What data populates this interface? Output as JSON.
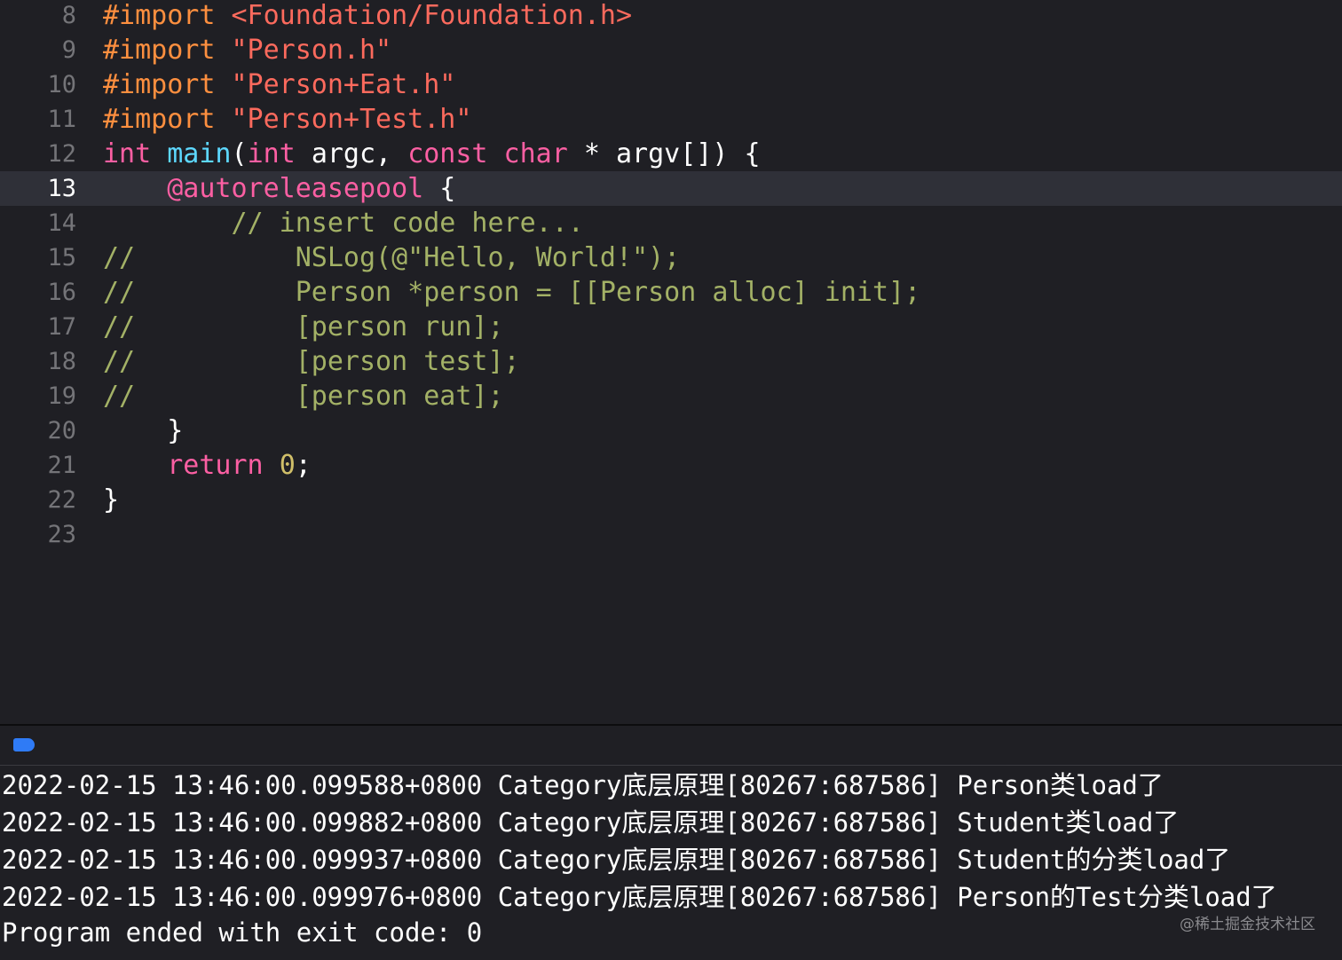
{
  "editor": {
    "current_line": 13,
    "lines": [
      {
        "num": "8",
        "parts": [
          {
            "t": "#import ",
            "c": "pp"
          },
          {
            "t": "<Foundation/Foundation.h>",
            "c": "str"
          }
        ]
      },
      {
        "num": "9",
        "parts": [
          {
            "t": "#import ",
            "c": "pp"
          },
          {
            "t": "\"Person.h\"",
            "c": "str"
          }
        ]
      },
      {
        "num": "10",
        "parts": [
          {
            "t": "#import ",
            "c": "pp"
          },
          {
            "t": "\"Person+Eat.h\"",
            "c": "str"
          }
        ]
      },
      {
        "num": "11",
        "parts": [
          {
            "t": "#import ",
            "c": "pp"
          },
          {
            "t": "\"Person+Test.h\"",
            "c": "str"
          }
        ]
      },
      {
        "num": "12",
        "parts": [
          {
            "t": "int ",
            "c": "kw"
          },
          {
            "t": "main",
            "c": "fnn"
          },
          {
            "t": "(",
            "c": "plain"
          },
          {
            "t": "int ",
            "c": "kw"
          },
          {
            "t": "argc, ",
            "c": "plain"
          },
          {
            "t": "const char ",
            "c": "kw"
          },
          {
            "t": "* argv[]) {",
            "c": "plain"
          }
        ]
      },
      {
        "num": "13",
        "parts": [
          {
            "t": "    ",
            "c": "plain"
          },
          {
            "t": "@autoreleasepool",
            "c": "kw"
          },
          {
            "t": " {",
            "c": "plain"
          }
        ]
      },
      {
        "num": "14",
        "parts": [
          {
            "t": "        // insert code here...",
            "c": "doc"
          }
        ]
      },
      {
        "num": "15",
        "parts": [
          {
            "t": "//          NSLog(@\"Hello, World!\");",
            "c": "doc"
          }
        ]
      },
      {
        "num": "16",
        "parts": [
          {
            "t": "//          Person *person = [[Person alloc] init];",
            "c": "doc"
          }
        ]
      },
      {
        "num": "17",
        "parts": [
          {
            "t": "//          [person run];",
            "c": "doc"
          }
        ]
      },
      {
        "num": "18",
        "parts": [
          {
            "t": "//          [person test];",
            "c": "doc"
          }
        ]
      },
      {
        "num": "19",
        "parts": [
          {
            "t": "//          [person eat];",
            "c": "doc"
          }
        ]
      },
      {
        "num": "20",
        "parts": [
          {
            "t": "    }",
            "c": "plain"
          }
        ]
      },
      {
        "num": "21",
        "parts": [
          {
            "t": "    ",
            "c": "plain"
          },
          {
            "t": "return ",
            "c": "kw"
          },
          {
            "t": "0",
            "c": "num"
          },
          {
            "t": ";",
            "c": "plain"
          }
        ]
      },
      {
        "num": "22",
        "parts": [
          {
            "t": "}",
            "c": "plain"
          }
        ]
      },
      {
        "num": "23",
        "parts": []
      }
    ]
  },
  "debug": {
    "toggle_color": "#2f7bf6"
  },
  "console": {
    "lines": [
      "2022-02-15 13:46:00.099588+0800 Category底层原理[80267:687586] Person类load了",
      "2022-02-15 13:46:00.099882+0800 Category底层原理[80267:687586] Student类load了",
      "2022-02-15 13:46:00.099937+0800 Category底层原理[80267:687586] Student的分类load了",
      "2022-02-15 13:46:00.099976+0800 Category底层原理[80267:687586] Person的Test分类load了",
      "Program ended with exit code: 0"
    ]
  },
  "watermark": "@稀土掘金技术社区"
}
